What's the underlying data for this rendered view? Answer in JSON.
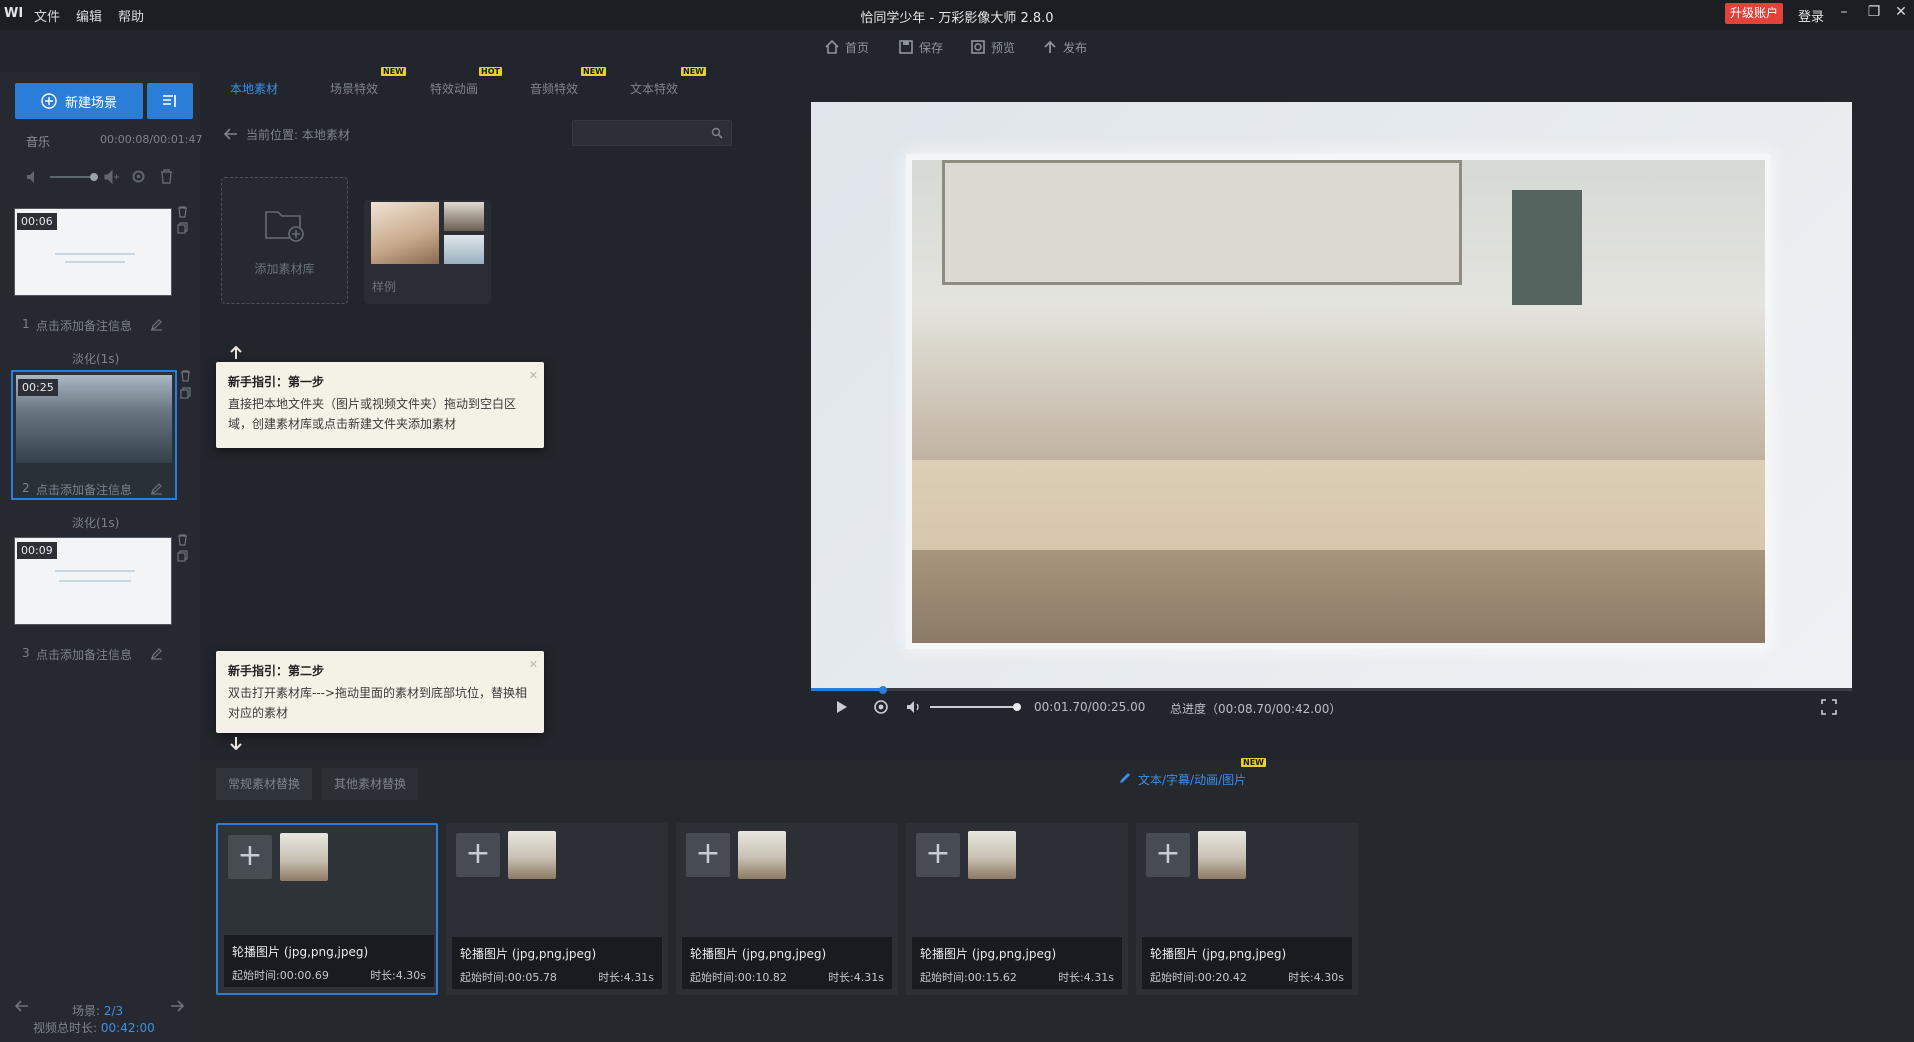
{
  "window": {
    "logo": "WI",
    "menu": [
      "文件",
      "编辑",
      "帮助"
    ],
    "title": "恰同学少年 - 万彩影像大师 2.8.0",
    "upgrade_label": "升级账户",
    "login_label": "登录"
  },
  "toolbar": {
    "home": "首页",
    "save": "保存",
    "preview": "预览",
    "publish": "发布"
  },
  "left": {
    "new_scene": "新建场景",
    "music_label": "音乐",
    "music_time": "00:00:08/00:01:47",
    "scenes": [
      {
        "time": "00:06",
        "index": "1",
        "note": "点击添加备注信息",
        "active": false
      },
      {
        "time": "00:25",
        "index": "2",
        "note": "点击添加备注信息",
        "active": true
      },
      {
        "time": "00:09",
        "index": "3",
        "note": "点击添加备注信息",
        "active": false
      }
    ],
    "transitions": [
      "淡化(1s)",
      "淡化(1s)"
    ],
    "scene_count_label": "场景:",
    "scene_count_value": "2/3",
    "video_total_label": "视频总时长:",
    "video_total_value": "00:42:00"
  },
  "library": {
    "tabs": [
      {
        "label": "本地素材",
        "badge": ""
      },
      {
        "label": "场景特效",
        "badge": "NEW"
      },
      {
        "label": "特效动画",
        "badge": "HOT"
      },
      {
        "label": "音频特效",
        "badge": "NEW"
      },
      {
        "label": "文本特效",
        "badge": "NEW"
      }
    ],
    "breadcrumb_label": "当前位置:",
    "breadcrumb_value": "本地素材",
    "add_library_label": "添加素材库",
    "sample_label": "样例"
  },
  "tips": [
    {
      "title": "新手指引：第一步",
      "body": "直接把本地文件夹（图片或视频文件夹）拖动到空白区域，创建素材库或点击新建文件夹添加素材"
    },
    {
      "title": "新手指引：第二步",
      "body": "双击打开素材库--->拖动里面的素材到底部坑位，替换相对应的素材"
    }
  ],
  "player": {
    "current_time": "00:01.70/00:25.00",
    "total_progress": "总进度（00:08.70/00:42.00）",
    "progress_fraction": 0.068
  },
  "bottom": {
    "tabs": [
      "常规素材替换",
      "其他素材替换"
    ],
    "right_actions": [
      "文本/字幕/动画/图片"
    ],
    "right_badge": "NEW",
    "slots": [
      {
        "title": "轮播图片 (jpg,png,jpeg)",
        "start": "起始时间:00:00.69",
        "duration": "时长:4.30s",
        "active": true
      },
      {
        "title": "轮播图片 (jpg,png,jpeg)",
        "start": "起始时间:00:05.78",
        "duration": "时长:4.31s",
        "active": false
      },
      {
        "title": "轮播图片 (jpg,png,jpeg)",
        "start": "起始时间:00:10.82",
        "duration": "时长:4.31s",
        "active": false
      },
      {
        "title": "轮播图片 (jpg,png,jpeg)",
        "start": "起始时间:00:15.62",
        "duration": "时长:4.31s",
        "active": false
      },
      {
        "title": "轮播图片 (jpg,png,jpeg)",
        "start": "起始时间:00:20.42",
        "duration": "时长:4.30s",
        "active": false
      }
    ]
  },
  "colors": {
    "accent": "#2b7ed8",
    "upgrade": "#e3423b",
    "badge": "#e6d22a"
  }
}
